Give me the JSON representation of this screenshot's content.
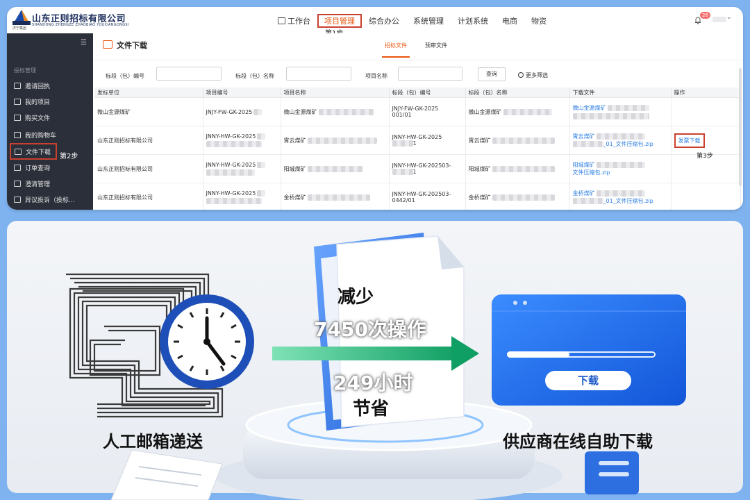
{
  "brand": {
    "name_cn": "山东正则招标有限公司",
    "name_en": "SHANDONG ZHENGZE ZHAOBIAO YOUXIANGONGSI",
    "logo_sub": "济宁集团"
  },
  "topnav": {
    "items": [
      "工作台",
      "项目管理",
      "综合办公",
      "系统管理",
      "计划系统",
      "电商",
      "物资"
    ],
    "active": "项目管理"
  },
  "notifications": {
    "count": "26"
  },
  "annotations": {
    "step1": "第1步",
    "step2": "第2步",
    "step3": "第3步"
  },
  "sidebar": {
    "section": "投标管理",
    "items": [
      "邀请回执",
      "我的项目",
      "购买文件",
      "我的购物车",
      "文件下载",
      "订单查询",
      "澄清管理",
      "异议投诉（投标..."
    ],
    "active": "文件下载"
  },
  "page": {
    "title": "文件下载",
    "tabs": [
      "招标文件",
      "预审文件"
    ],
    "active_tab": "招标文件"
  },
  "filters": {
    "section_no_label": "标段（包）编号",
    "section_name_label": "标段（包）名称",
    "project_name_label": "项目名称",
    "query_button": "查询",
    "more_filter": "更多筛选"
  },
  "table": {
    "columns": [
      "发标单位",
      "项目编号",
      "项目名称",
      "标段（包）编号",
      "标段（包）名称",
      "下载文件",
      "操作"
    ],
    "rows": [
      {
        "unit": "微山金源煤矿",
        "project_no": "JNJY-FW-GK-2025",
        "project_name": "微山金源煤矿",
        "section_no": "JNJY-FW-GK-2025",
        "section_no2": "001/01",
        "section_name": "微山金源煤矿",
        "file": "微山金源煤矿",
        "file2": "",
        "action": ""
      },
      {
        "unit": "山东正则招标有限公司",
        "project_no": "JNNY-HW-GK-2025",
        "project_name": "霄云煤矿",
        "section_no": "JNNY-HW-GK-2025",
        "section_no2": "1",
        "section_name": "霄云煤矿",
        "file": "霄云煤矿",
        "file2": "_01_文件压缩包.zip",
        "action": "发票下载"
      },
      {
        "unit": "山东正则招标有限公司",
        "project_no": "JNNY-HW-GK-2025",
        "project_name": "阳城煤矿",
        "section_no": "JNNY-HW-GK-202503-",
        "section_no2": "1",
        "section_name": "阳城煤矿",
        "file": "阳城煤矿",
        "file2": "文件压缩包.zip",
        "action": ""
      },
      {
        "unit": "山东正则招标有限公司",
        "project_no": "JNNY-HW-GK-2025",
        "project_name": "金桥煤矿",
        "section_no": "JNNY-HW-GK-202503-",
        "section_no2": "0442/01",
        "section_name": "金桥煤矿",
        "file": "金桥煤矿",
        "file2": "_01_文件压缩包.zip",
        "action": ""
      }
    ]
  },
  "illustration": {
    "left_label": "人工邮箱递送",
    "reduce_label": "减少",
    "ops_count": "7450次操作",
    "hours": "249小时",
    "save_label": "节省",
    "right_label": "供应商在线自助下载",
    "download_button": "下载",
    "progress": 0.42
  },
  "colors": {
    "accent_orange": "#e8540c",
    "highlight_red": "#c9402f",
    "link_blue": "#2b7de0",
    "panel_blue": "#1b6fe0",
    "arrow_green": "#17a86b"
  }
}
